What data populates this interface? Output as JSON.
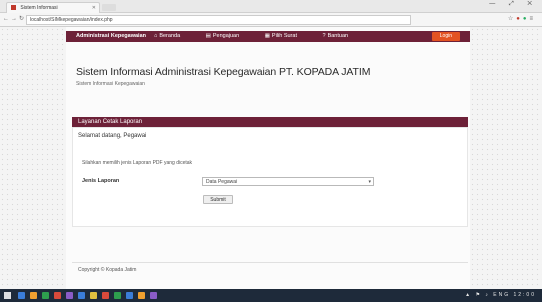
{
  "browser": {
    "tab_title": "Sistem Informasi",
    "url": "localhost/SIMkepegawaian/index.php",
    "window_buttons": "— ⤢ ✕"
  },
  "navbar": {
    "brand": "Administrasi Kepegawaian",
    "menu": [
      {
        "label": "Beranda"
      },
      {
        "label": "Pengajuan"
      },
      {
        "label": "Pilih Surat"
      },
      {
        "label": "Bantuan"
      }
    ],
    "login": "Login"
  },
  "header": {
    "title": "Sistem Informasi Administrasi Kepegawaian PT. KOPADA JATIM",
    "subtitle": "Sistem Informasi Kepegawaian"
  },
  "panel": {
    "title": "Layanan Cetak Laporan",
    "welcome": "Selamat datang, Pegawai"
  },
  "form": {
    "hint": "Silahkan memilih jenis Laporan PDF yang dicetak",
    "label": "Jenis Laporan",
    "select_value": "Data Pegawai",
    "submit_label": "Submit"
  },
  "footer": {
    "text": "Copyright © Kopada Jatim"
  },
  "taskbar": {
    "icon_colors": [
      "#3b7dd8",
      "#f0a030",
      "#2e9e4e",
      "#d84a3b",
      "#8a5cc7",
      "#3b7dd8",
      "#e0c040",
      "#d84a3b",
      "#2e9e4e",
      "#3b7dd8",
      "#f0a030",
      "#8a5cc7"
    ],
    "tray_text": "▲ ⚑ ♪ ENG 12:00"
  },
  "colors": {
    "brand": "#6d2138",
    "login_button": "#e35322"
  }
}
